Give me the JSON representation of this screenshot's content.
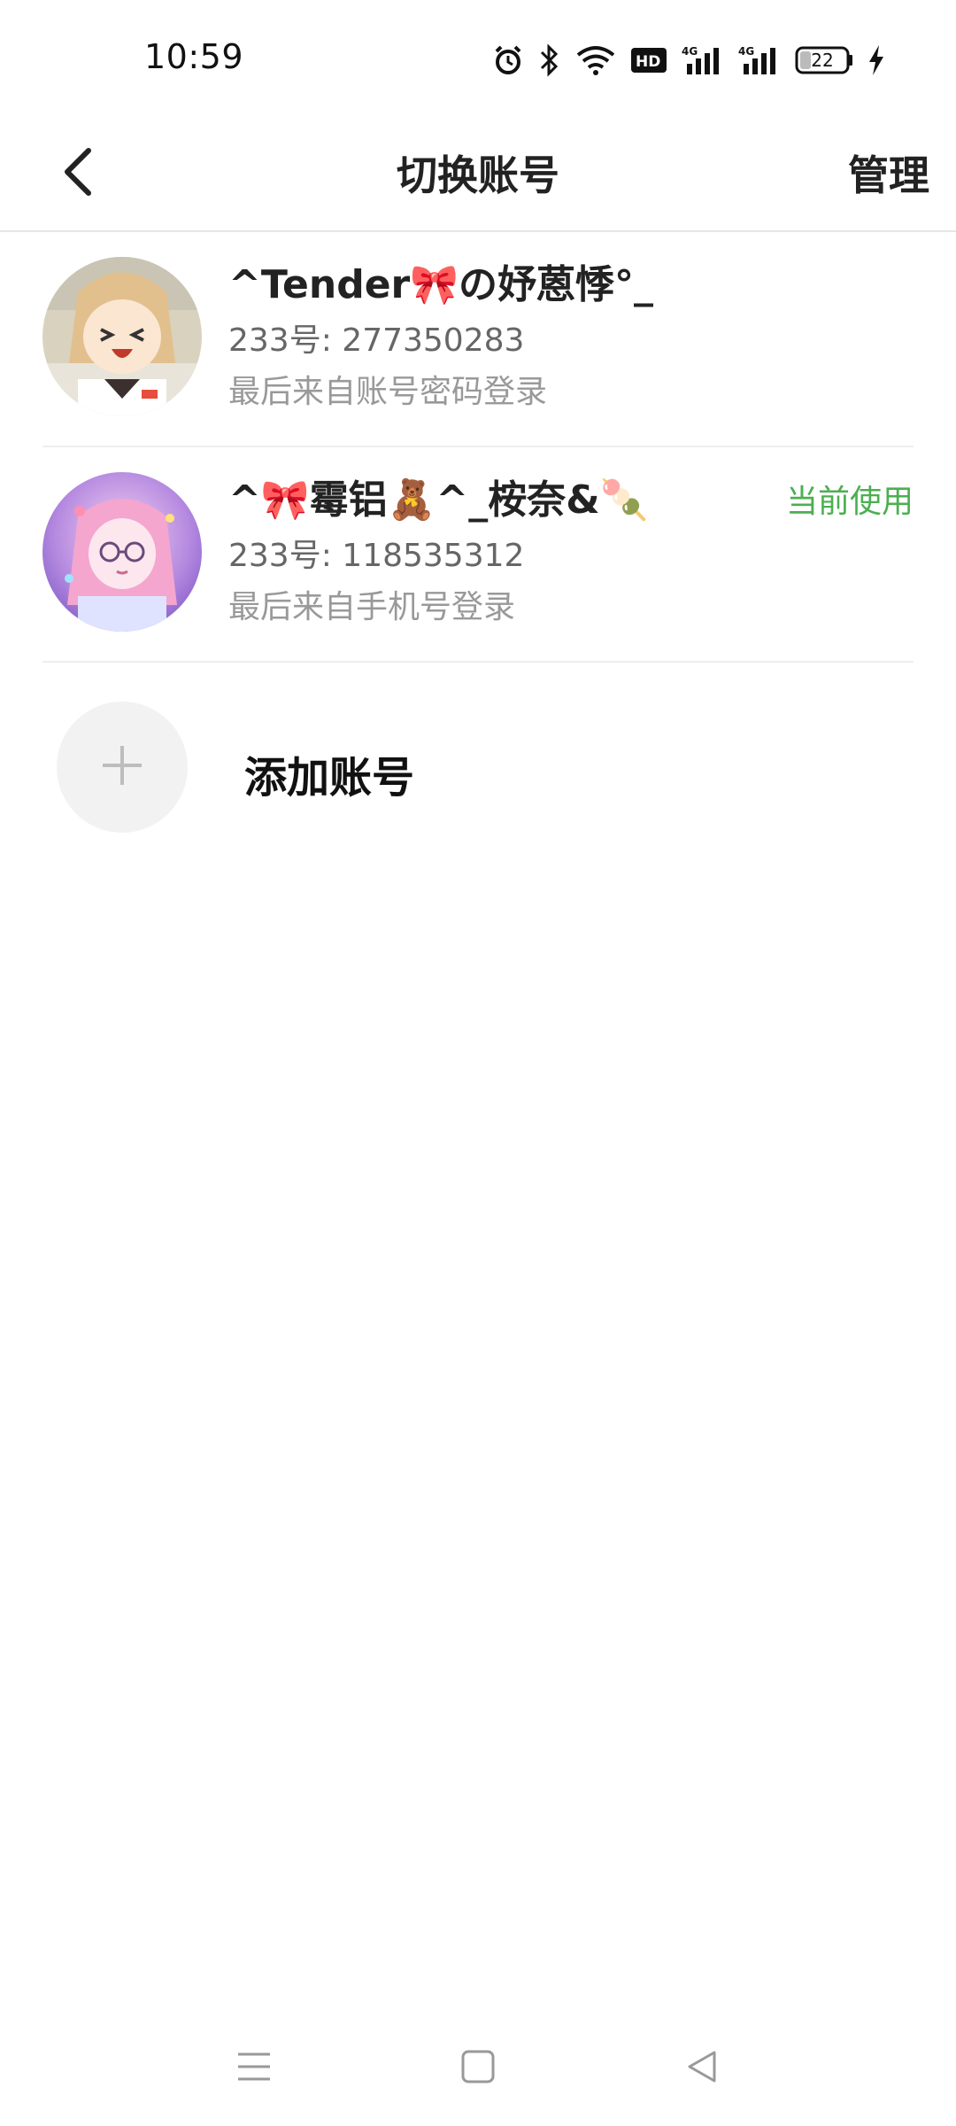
{
  "status_bar": {
    "time": "10:59",
    "battery": "22",
    "icons": [
      "alarm-icon",
      "bluetooth-icon",
      "wifi-icon",
      "hd-icon",
      "signal-4g-icon",
      "signal-4g-icon",
      "battery-icon",
      "charging-icon"
    ]
  },
  "header": {
    "title": "切换账号",
    "manage_label": "管理",
    "back_icon": "chevron-left-icon"
  },
  "accounts": [
    {
      "name": "^Tender🎀の妤蒽悸°_",
      "id_line": "233号: 277350283",
      "login_source": "最后来自账号密码登录",
      "current": false
    },
    {
      "name": "^🎀霉铝🧸^_桉奈&🍡",
      "id_line": "233号: 118535312",
      "login_source": "最后来自手机号登录",
      "current": true,
      "current_label": "当前使用"
    }
  ],
  "add_account": {
    "label": "添加账号",
    "icon": "plus-icon"
  },
  "colors": {
    "accent_green": "#4caf50",
    "divider": "#eeeeee"
  },
  "bottom_nav": [
    "menu-icon",
    "home-square-icon",
    "back-triangle-icon"
  ]
}
